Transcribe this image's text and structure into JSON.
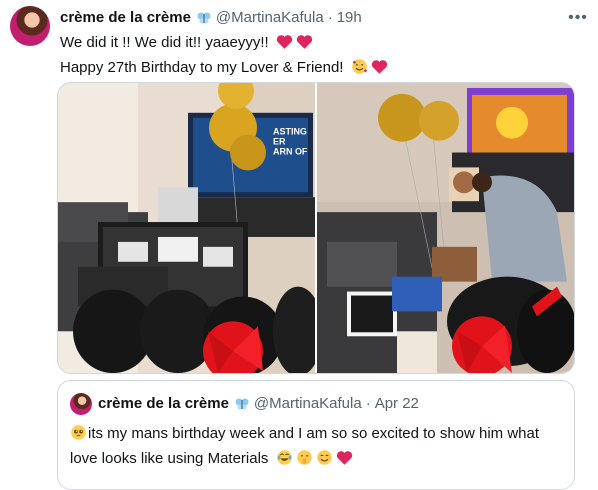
{
  "tweet": {
    "display_name": "crème de la crème",
    "handle": "@MartinaKafula",
    "separator": "·",
    "time": "19h",
    "more_label": "•••",
    "line1": "We did it !! We did it!!  yaaeyyy!!",
    "line2": "Happy 27th Birthday to my Lover & Friend!"
  },
  "media": {
    "photo_left": {
      "tv_text_lines": [
        "ASTING",
        "ER",
        "ARN OF"
      ]
    },
    "photo_right": {}
  },
  "quote": {
    "display_name": "crème de la crème",
    "handle": "@MartinaKafula",
    "separator": "·",
    "date": "Apr 22",
    "line1": "its my mans birthday week and I am so so excited to show him what",
    "line2": "love looks like using Materials"
  },
  "icons": {
    "verified": "butterfly-badge-icon",
    "hearts": "red-heart-icon",
    "love_face": "smiling-face-with-hearts-icon",
    "pleading": "pleading-face-icon",
    "laugh": "tears-of-joy-icon",
    "shush": "shushing-face-icon",
    "blush": "smiling-face-icon"
  },
  "colors": {
    "text": "#0f1419",
    "muted": "#536471",
    "border": "#cfd9de",
    "heart": "#e0245e"
  }
}
